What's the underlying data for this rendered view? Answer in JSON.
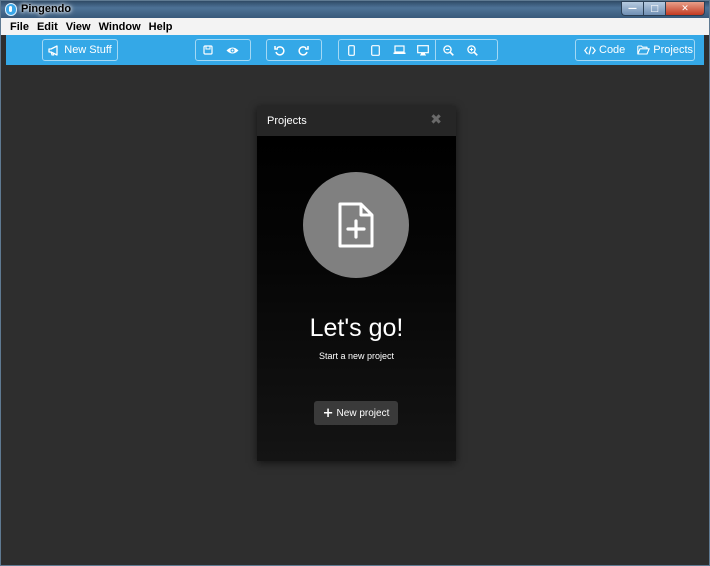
{
  "window": {
    "title": "Pingendo"
  },
  "window_controls": {
    "minimize": "—",
    "maximize": "□",
    "close": "✕"
  },
  "menubar": {
    "items": [
      "File",
      "Edit",
      "View",
      "Window",
      "Help"
    ]
  },
  "toolbar": {
    "new_stuff_label": "New Stuff",
    "code_label": "Code",
    "projects_label": "Projects",
    "icons": [
      "megaphone-icon",
      "save-icon",
      "eye-icon",
      "undo-icon",
      "redo-icon",
      "phone-icon",
      "tablet-icon",
      "laptop-icon",
      "desktop-icon",
      "zoom-out-icon",
      "zoom-in-icon",
      "code-icon",
      "folder-open-icon"
    ],
    "accent": "#34a8e7"
  },
  "modal": {
    "title": "Projects",
    "close": "✖",
    "headline": "Let's go!",
    "subtitle": "Start a new project",
    "button_plus": "+",
    "button_label": "New project",
    "circle_color": "#808080"
  },
  "colors": {
    "canvas": "#2e2e2e",
    "modal_header": "#262626"
  }
}
